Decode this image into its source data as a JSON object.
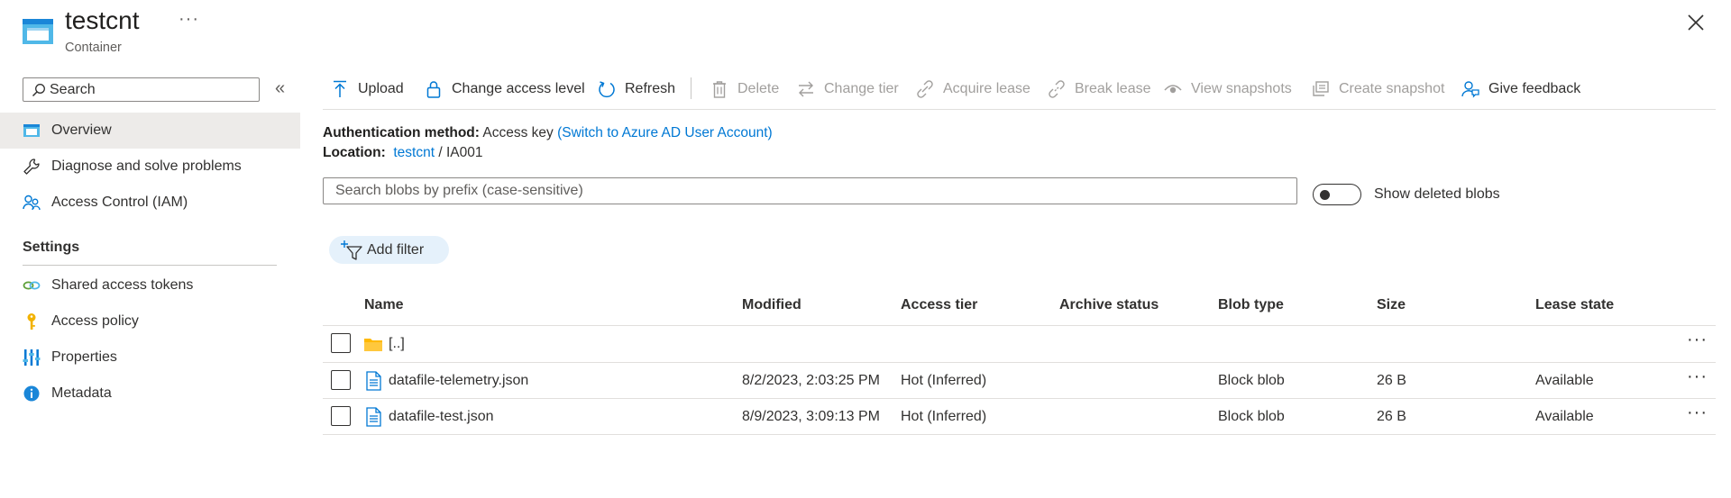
{
  "header": {
    "title": "testcnt",
    "subtitle": "Container",
    "more_label": "···",
    "close_label": "close"
  },
  "sidebar": {
    "search_placeholder": "Search",
    "collapse_label": "«",
    "items": [
      {
        "label": "Overview",
        "icon": "container-icon",
        "active": true
      },
      {
        "label": "Diagnose and solve problems",
        "icon": "wrench-icon"
      },
      {
        "label": "Access Control (IAM)",
        "icon": "people-icon"
      }
    ],
    "settings_header": "Settings",
    "settings_items": [
      {
        "label": "Shared access tokens",
        "icon": "link-icon"
      },
      {
        "label": "Access policy",
        "icon": "key-icon"
      },
      {
        "label": "Properties",
        "icon": "properties-icon"
      },
      {
        "label": "Metadata",
        "icon": "info-icon"
      }
    ]
  },
  "toolbar": {
    "upload": "Upload",
    "change_access_level": "Change access level",
    "refresh": "Refresh",
    "delete": "Delete",
    "change_tier": "Change tier",
    "acquire_lease": "Acquire lease",
    "break_lease": "Break lease",
    "view_snapshots": "View snapshots",
    "create_snapshot": "Create snapshot",
    "give_feedback": "Give feedback"
  },
  "info": {
    "auth_label": "Authentication method:",
    "auth_value": "Access key",
    "auth_link": "(Switch to Azure AD User Account)",
    "location_label": "Location:",
    "location_link": "testcnt",
    "location_sep": "/",
    "location_path": "IA001"
  },
  "blob_search": {
    "placeholder": "Search blobs by prefix (case-sensitive)",
    "value": ""
  },
  "toggle": {
    "label": "Show deleted blobs",
    "on": false
  },
  "filter": {
    "add_label": "Add filter"
  },
  "table": {
    "columns": [
      "Name",
      "Modified",
      "Access tier",
      "Archive status",
      "Blob type",
      "Size",
      "Lease state"
    ],
    "rows": [
      {
        "name": "[..]",
        "modified": "",
        "tier": "",
        "archive": "",
        "type": "",
        "size": "",
        "lease": "",
        "icon": "folder-icon"
      },
      {
        "name": "datafile-telemetry.json",
        "modified": "8/2/2023, 2:03:25 PM",
        "tier": "Hot (Inferred)",
        "archive": "",
        "type": "Block blob",
        "size": "26 B",
        "lease": "Available",
        "icon": "file-icon"
      },
      {
        "name": "datafile-test.json",
        "modified": "8/9/2023, 3:09:13 PM",
        "tier": "Hot (Inferred)",
        "archive": "",
        "type": "Block blob",
        "size": "26 B",
        "lease": "Available",
        "icon": "file-icon"
      }
    ],
    "row_more_label": "···"
  },
  "colors": {
    "accent": "#0078d4",
    "folder": "#ffb900",
    "nav_active_bg": "#edebe9",
    "filter_pill_bg": "#e5f1fb",
    "disabled_text": "#a19f9d"
  }
}
